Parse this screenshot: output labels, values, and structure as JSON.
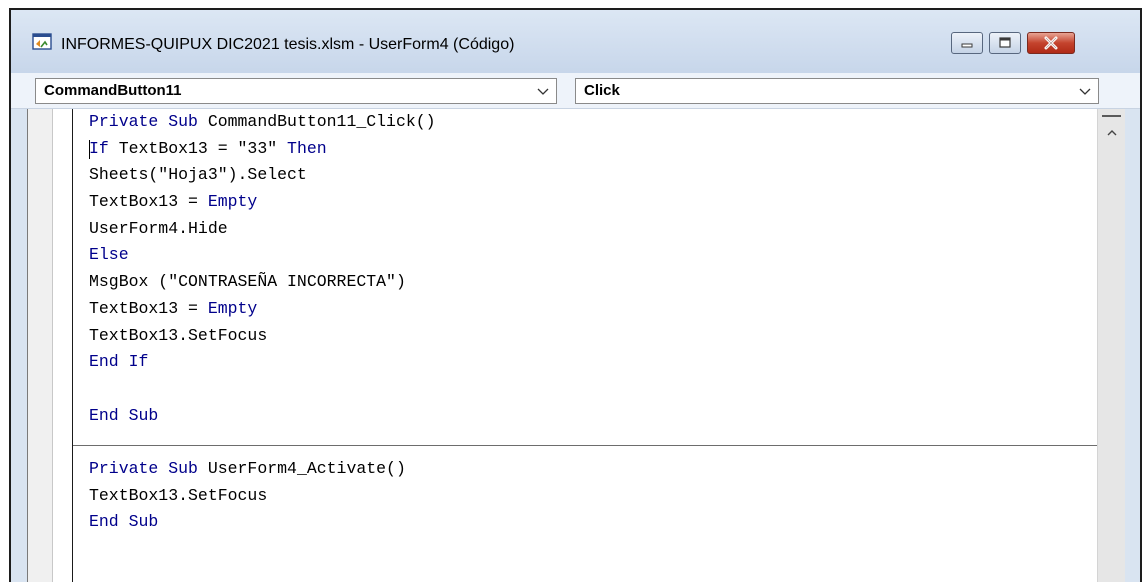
{
  "window": {
    "title": "INFORMES-QUIPUX DIC2021 tesis.xlsm - UserForm4 (Código)",
    "icon": "vba-code-window-icon",
    "controls": {
      "minimize_icon": "minimize-icon",
      "maximize_icon": "maximize-icon",
      "close_icon": "close-icon"
    }
  },
  "toolbar": {
    "object_dropdown": {
      "value": "CommandButton11"
    },
    "procedure_dropdown": {
      "value": "Click"
    }
  },
  "code": {
    "proc1": {
      "line1": {
        "kw1": "Private Sub",
        "rest": " CommandButton11_Click()"
      },
      "line2": {
        "kw1": "If",
        "mid": " TextBox13 = \"33\" ",
        "kw2": "Then"
      },
      "line3": {
        "text": "Sheets(\"Hoja3\").Select"
      },
      "line4": {
        "pre": "TextBox13 = ",
        "kw": "Empty"
      },
      "line5": {
        "text": "UserForm4.Hide"
      },
      "line6": {
        "kw": "Else"
      },
      "line7": {
        "text": "MsgBox (\"CONTRASEÑA INCORRECTA\")"
      },
      "line8": {
        "pre": "TextBox13 = ",
        "kw": "Empty"
      },
      "line9": {
        "text": "TextBox13.SetFocus"
      },
      "line10": {
        "kw": "End If"
      },
      "line11": {
        "text": ""
      },
      "line12": {
        "kw": "End Sub"
      }
    },
    "proc2": {
      "line1": {
        "kw1": "Private Sub",
        "rest": " UserForm4_Activate()"
      },
      "line2": {
        "text": "TextBox13.SetFocus"
      },
      "line3": {
        "kw": "End Sub"
      }
    }
  },
  "colors": {
    "keyword": "#00008b",
    "text": "#000000",
    "title_bar": "#d9e4f1",
    "close_button": "#c4432d"
  }
}
